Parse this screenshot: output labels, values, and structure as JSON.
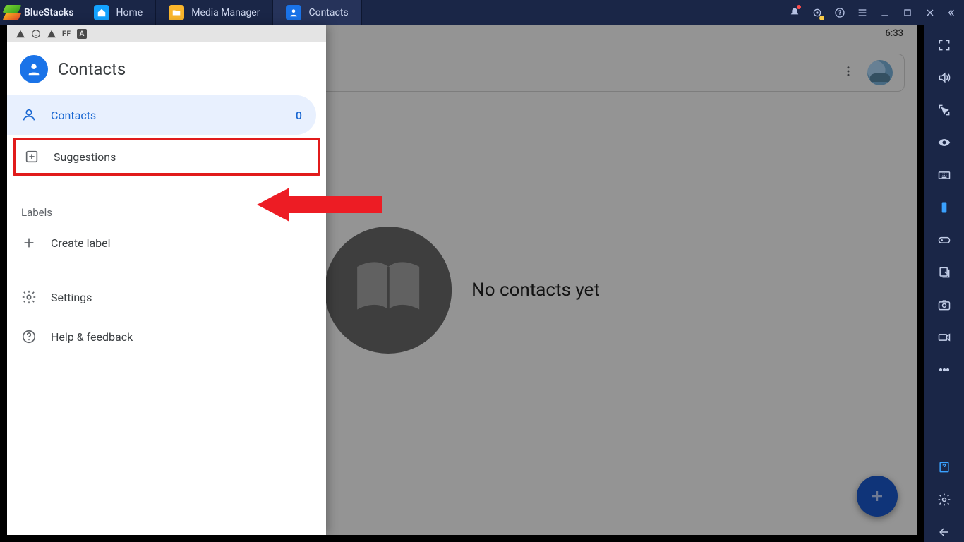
{
  "brand": "BlueStacks",
  "tabs": [
    {
      "label": "Home"
    },
    {
      "label": "Media Manager"
    },
    {
      "label": "Contacts"
    }
  ],
  "clock": "6:33",
  "drawer": {
    "title": "Contacts",
    "contacts_label": "Contacts",
    "contacts_count": "0",
    "suggestions_label": "Suggestions",
    "labels_header": "Labels",
    "create_label": "Create label",
    "settings_label": "Settings",
    "help_label": "Help & feedback"
  },
  "main": {
    "empty_text": "No contacts yet"
  },
  "statusbar": {
    "ff": "FF",
    "a": "A"
  }
}
